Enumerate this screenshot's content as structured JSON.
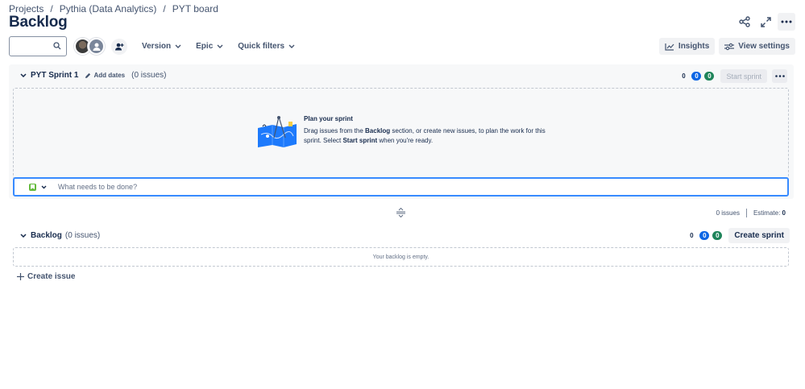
{
  "breadcrumb": {
    "items": [
      "Projects",
      "Pythia (Data Analytics)",
      "PYT board"
    ],
    "separator": "/"
  },
  "page": {
    "title": "Backlog"
  },
  "header_actions": {
    "icons": [
      "share-icon",
      "expand-icon",
      "more-icon"
    ]
  },
  "toolbar": {
    "search_placeholder": "",
    "filters": [
      "Version",
      "Epic",
      "Quick filters"
    ],
    "insights_label": "Insights",
    "view_settings_label": "View settings"
  },
  "sprint": {
    "name": "PYT Sprint 1",
    "add_dates_label": "Add dates",
    "issue_count_text": "(0 issues)",
    "status_counts": {
      "todo": "0",
      "in_progress": "0",
      "done": "0"
    },
    "start_label": "Start sprint",
    "plan_title": "Plan your sprint",
    "plan_line1_a": "Drag issues from the ",
    "plan_line1_b": "Backlog",
    "plan_line1_c": " section, or create new issues, to plan the work for this",
    "plan_line2_a": "sprint. Select ",
    "plan_line2_b": "Start sprint",
    "plan_line2_c": " when you're ready.",
    "create_placeholder": "What needs to be done?",
    "summary_issues": "0 issues",
    "summary_estimate_label": "Estimate:",
    "summary_estimate_value": "0"
  },
  "backlog": {
    "title": "Backlog",
    "issue_count_text": "(0 issues)",
    "status_counts": {
      "todo": "0",
      "in_progress": "0",
      "done": "0"
    },
    "create_sprint_label": "Create sprint",
    "empty_text": "Your backlog is empty.",
    "create_issue_label": "Create issue"
  },
  "colors": {
    "accent_blue": "#0c66e4",
    "done_green": "#1f845a",
    "focus_blue": "#388bff"
  }
}
